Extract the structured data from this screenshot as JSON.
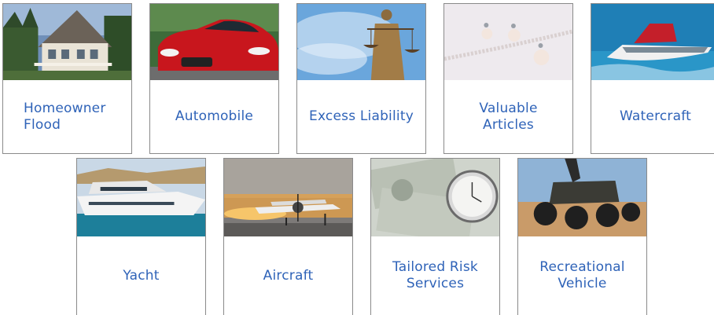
{
  "cards": [
    {
      "label": "Homeowner\nFlood",
      "image": "house-photo"
    },
    {
      "label": "Automobile",
      "image": "red-car-photo"
    },
    {
      "label": "Excess Liability",
      "image": "justice-statue-photo"
    },
    {
      "label": "Valuable Articles",
      "image": "pearl-jewelry-photo"
    },
    {
      "label": "Watercraft",
      "image": "jet-ski-photo"
    },
    {
      "label": "Yacht",
      "image": "yacht-photo"
    },
    {
      "label": "Aircraft",
      "image": "airplane-photo"
    },
    {
      "label": "Tailored Risk\nServices",
      "image": "money-pocketwatch-photo"
    },
    {
      "label": "Recreational\nVehicle",
      "image": "atv-photo"
    }
  ],
  "colors": {
    "label": "#2f63b8",
    "border": "#8a8a8a"
  }
}
